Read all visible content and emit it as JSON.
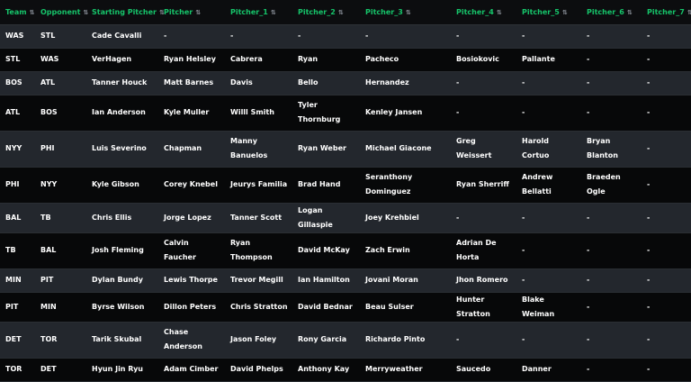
{
  "columns": [
    "Team",
    "Opponent",
    "Starting Pitcher",
    "Pitcher",
    "Pitcher_1",
    "Pitcher_2",
    "Pitcher_3",
    "Pitcher_4",
    "Pitcher_5",
    "Pitcher_6",
    "Pitcher_7"
  ],
  "rows": [
    [
      "WAS",
      "STL",
      "Cade Cavalli",
      "-",
      "-",
      "-",
      "-",
      "-",
      "-",
      "-",
      "-"
    ],
    [
      "STL",
      "WAS",
      "VerHagen",
      "Ryan Helsley",
      "Cabrera",
      "Ryan",
      "Pacheco",
      "Bosiokovic",
      "Pallante",
      "-",
      "-"
    ],
    [
      "BOS",
      "ATL",
      "Tanner Houck",
      "Matt Barnes",
      "Davis",
      "Bello",
      "Hernandez",
      "-",
      "-",
      "-",
      "-"
    ],
    [
      "ATL",
      "BOS",
      "Ian Anderson",
      "Kyle Muller",
      "Willl Smith",
      "Tyler Thornburg",
      "Kenley Jansen",
      "-",
      "-",
      "-",
      "-"
    ],
    [
      "NYY",
      "PHI",
      "Luis Severino",
      "Chapman",
      "Manny Banuelos",
      "Ryan Weber",
      "Michael Giacone",
      "Greg Weissert",
      "Harold Cortuo",
      "Bryan Blanton",
      "-"
    ],
    [
      "PHI",
      "NYY",
      "Kyle Gibson",
      "Corey Knebel",
      "Jeurys Familia",
      "Brad Hand",
      "Seranthony Dominguez",
      "Ryan Sherriff",
      "Andrew Bellatti",
      "Braeden Ogle",
      "-"
    ],
    [
      "BAL",
      "TB",
      "Chris Ellis",
      "Jorge Lopez",
      "Tanner Scott",
      "Logan Gillaspie",
      "Joey Krehbiel",
      "-",
      "-",
      "-",
      "-"
    ],
    [
      "TB",
      "BAL",
      "Josh Fleming",
      "Calvin Faucher",
      "Ryan Thompson",
      "David McKay",
      "Zach Erwin",
      "Adrian De Horta",
      "-",
      "-",
      "-"
    ],
    [
      "MIN",
      "PIT",
      "Dylan Bundy",
      "Lewis Thorpe",
      "Trevor Megill",
      "Ian Hamilton",
      "Jovani Moran",
      "Jhon Romero",
      "-",
      "-",
      "-"
    ],
    [
      "PIT",
      "MIN",
      "Byrse Wilson",
      "Dillon Peters",
      "Chris Stratton",
      "David Bednar",
      "Beau Sulser",
      "Hunter Stratton",
      "Blake Weiman",
      "-",
      "-"
    ],
    [
      "DET",
      "TOR",
      "Tarik Skubal",
      "Chase Anderson",
      "Jason Foley",
      "Rony Garcia",
      "Richardo Pinto",
      "-",
      "-",
      "-",
      "-"
    ],
    [
      "TOR",
      "DET",
      "Hyun Jin Ryu",
      "Adam Cimber",
      "David Phelps",
      "Anthony Kay",
      "Merryweather",
      "Saucedo",
      "Danner",
      "-",
      "-"
    ]
  ]
}
